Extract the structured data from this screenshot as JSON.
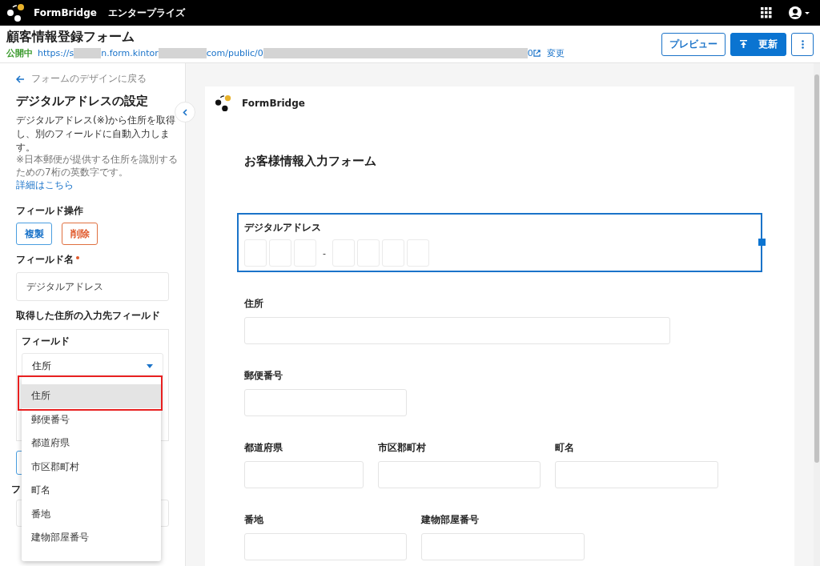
{
  "topbar": {
    "brand": "FormBridge",
    "edition": "エンタープライズ"
  },
  "header": {
    "title": "顧客情報登録フォーム",
    "status": "公開中",
    "url_parts": [
      "https://s",
      "n.form.kintor",
      "com/public/0",
      "0"
    ],
    "change_link": "変更",
    "buttons": [
      {
        "kind": "outline",
        "label": "プレビュー"
      },
      {
        "kind": "primary",
        "label": "更新"
      },
      {
        "kind": "more"
      }
    ]
  },
  "sidebar": {
    "back_link": "フォームのデザインに戻る",
    "title": "デジタルアドレスの設定",
    "description": "デジタルアドレス(※)から住所を取得し、別のフィールドに自動入力します。",
    "note": "※日本郵便が提供する住所を識別するための7桁の英数字です。",
    "note_link": "詳細はこちら",
    "operations_label": "フィールド操作",
    "operation_buttons": [
      {
        "kind": "copy",
        "label": "複製"
      },
      {
        "kind": "delete",
        "label": "削除"
      }
    ],
    "field_name_label": "フィールド名",
    "field_name_required": true,
    "field_name_value": "デジタルアドレス",
    "target_label": "取得した住所の入力先フィールド",
    "target_sub_label": "フィールド",
    "target_value": "住所",
    "covered_label": "フ",
    "dropdown": {
      "highlighted": true,
      "items": [
        {
          "label": "住所",
          "selected": true
        },
        {
          "label": "郵便番号",
          "selected": false
        },
        {
          "label": "都道府県",
          "selected": false
        },
        {
          "label": "市区郡町村",
          "selected": false
        },
        {
          "label": "町名",
          "selected": false
        },
        {
          "label": "番地",
          "selected": false
        },
        {
          "label": "建物部屋番号",
          "selected": false
        }
      ]
    }
  },
  "form": {
    "brand": "FormBridge",
    "title": "お客様情報入力フォーム",
    "digital_address": {
      "label": "デジタルアドレス",
      "selected": true,
      "separator": "-"
    },
    "rows": [
      [
        {
          "label": "住所"
        }
      ],
      [
        {
          "label": "郵便番号"
        }
      ],
      [
        {
          "label": "都道府県"
        },
        {
          "label": "市区郡町村"
        },
        {
          "label": "町名"
        }
      ],
      [
        {
          "label": "番地"
        },
        {
          "label": "建物部屋番号"
        }
      ]
    ]
  }
}
